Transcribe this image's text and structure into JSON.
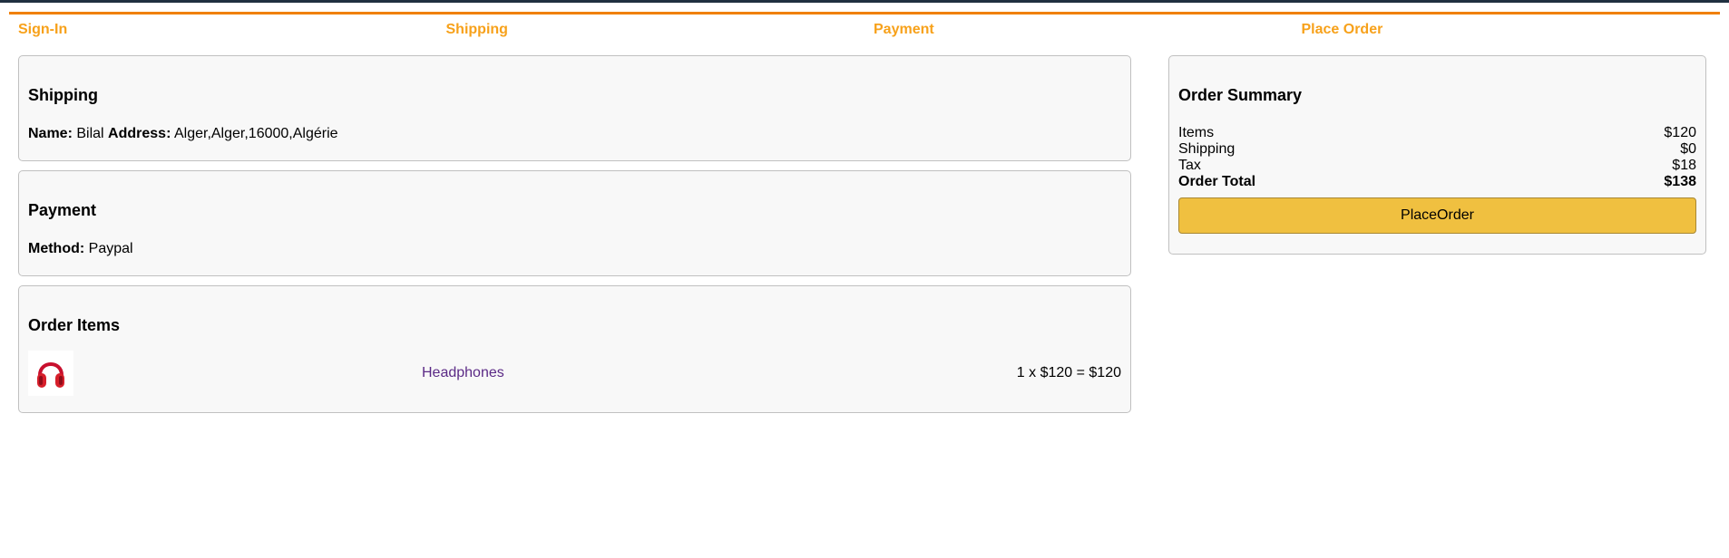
{
  "checkout_steps": [
    {
      "label": "Sign-In"
    },
    {
      "label": "Shipping"
    },
    {
      "label": "Payment"
    },
    {
      "label": "Place Order"
    }
  ],
  "shipping": {
    "title": "Shipping",
    "name_label": "Name:",
    "name_value": "Bilal",
    "address_label": "Address:",
    "address_value": "Alger,Alger,16000,Algérie"
  },
  "payment": {
    "title": "Payment",
    "method_label": "Method:",
    "method_value": "Paypal"
  },
  "order_items": {
    "title": "Order Items",
    "items": [
      {
        "name": "Headphones",
        "icon": "headphones-product-image",
        "price_line": "1 x $120 = $120"
      }
    ]
  },
  "summary": {
    "title": "Order Summary",
    "rows": [
      {
        "label": "Items",
        "value": "$120"
      },
      {
        "label": "Shipping",
        "value": "$0"
      },
      {
        "label": "Tax",
        "value": "$18"
      },
      {
        "label": "Order Total",
        "value": "$138"
      }
    ],
    "button_label": "PlaceOrder"
  },
  "colors": {
    "step_active": "#f7a11a",
    "button": "#f0c040",
    "link": "#5b2a86"
  }
}
